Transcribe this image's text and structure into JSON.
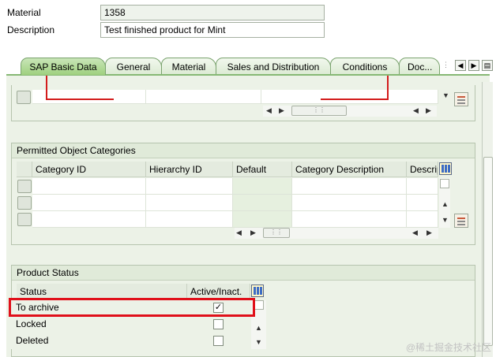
{
  "header": {
    "material_label": "Material",
    "material_value": "1358",
    "description_label": "Description",
    "description_value": "Test finished product for Mint"
  },
  "tabs": [
    {
      "label": "SAP Basic Data",
      "active": true
    },
    {
      "label": "General"
    },
    {
      "label": "Material"
    },
    {
      "label": "Sales and Distribution"
    },
    {
      "label": "Conditions"
    },
    {
      "label": "Doc..."
    }
  ],
  "permitted_object_categories": {
    "title": "Permitted Object Categories",
    "columns": [
      "Category ID",
      "Hierarchy ID",
      "Default",
      "Category Description",
      "Descrip"
    ]
  },
  "product_status": {
    "title": "Product Status",
    "columns": [
      "Status",
      "Active/Inact."
    ],
    "rows": [
      {
        "status": "To archive",
        "active": true
      },
      {
        "status": "Locked",
        "active": false
      },
      {
        "status": "Deleted",
        "active": false
      }
    ]
  },
  "icons": {
    "tab_nav": [
      "tab-list-icon",
      "tab-prev-icon",
      "tab-next-icon",
      "tab-menu-icon"
    ],
    "table_settings": "table-settings-icon",
    "row_details": "details-icon"
  },
  "highlight_color": "#e0101a",
  "watermark": "@稀土掘金技术社区"
}
